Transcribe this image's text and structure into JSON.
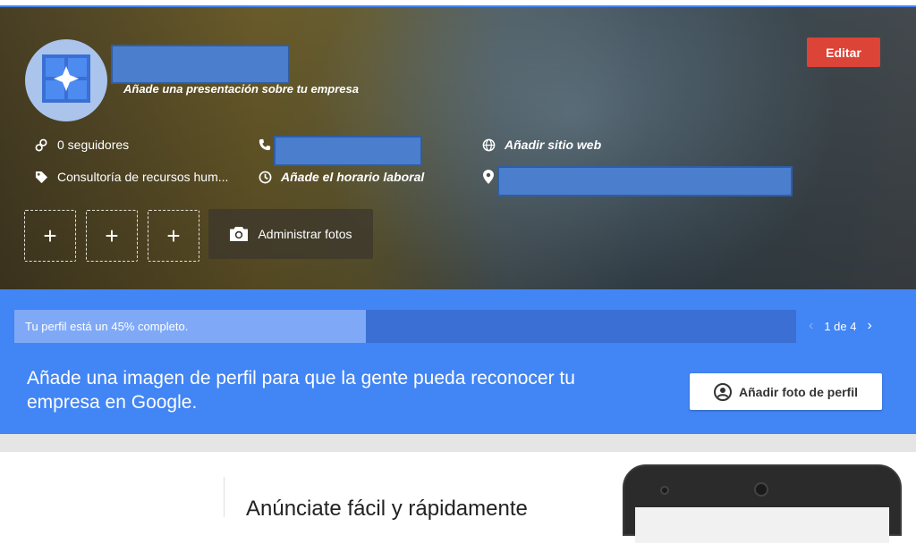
{
  "header": {
    "intro_link": "Añade una presentación sobre tu empresa",
    "edit_label": "Editar"
  },
  "info": {
    "followers": "0 seguidores",
    "category": "Consultoría de recursos hum...",
    "hours": "Añade el horario laboral",
    "website": "Añadir sitio web"
  },
  "photos": {
    "add_symbol": "+",
    "manage_label": "Administrar fotos"
  },
  "progress": {
    "text": "Tu perfil está un 45% completo.",
    "percent": 45,
    "pager": "1 de 4",
    "prompt": "Añade una imagen de perfil para que la gente pueda reconocer tu empresa en Google.",
    "add_photo_label": "Añadir foto de perfil"
  },
  "promo": {
    "title": "Anúnciate fácil y rápidamente"
  },
  "colors": {
    "accent_blue": "#4285f4",
    "edit_red": "#db4437"
  },
  "icons": [
    "business-logo-icon",
    "followers-icon",
    "tag-icon",
    "phone-icon",
    "clock-icon",
    "globe-icon",
    "location-pin-icon",
    "camera-icon",
    "account-circle-icon",
    "chevron-left-icon",
    "chevron-right-icon"
  ]
}
